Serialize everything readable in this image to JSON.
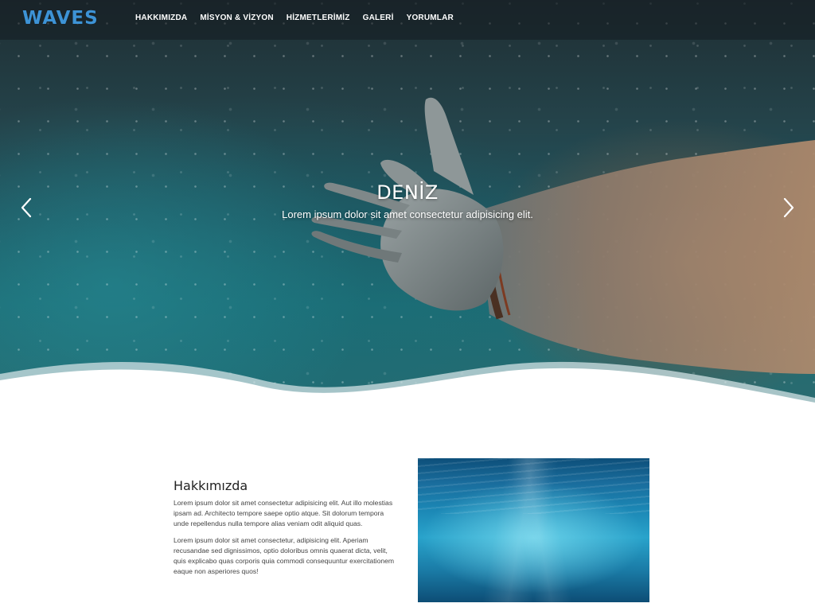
{
  "brand": {
    "logo_text": "WAVES",
    "logo_color": "#3d93d6"
  },
  "nav": {
    "items": [
      {
        "label": "HAKKIMIZDA"
      },
      {
        "label": "MİSYON & VİZYON"
      },
      {
        "label": "HİZMETLERİMİZ"
      },
      {
        "label": "GALERİ"
      },
      {
        "label": "YORUMLAR"
      }
    ]
  },
  "hero": {
    "title": "DENİZ",
    "subtitle": "Lorem ipsum dolor sit amet consectetur adipisicing elit.",
    "prev_icon": "chevron-left-icon",
    "next_icon": "chevron-right-icon"
  },
  "about": {
    "title": "Hakkımızda",
    "paragraphs": [
      "Lorem ipsum dolor sit amet consectetur adipisicing elit. Aut illo molestias ipsam ad. Architecto tempore saepe optio atque. Sit dolorum tempora unde repellendus nulla tempore alias veniam odit aliquid quas.",
      "Lorem ipsum dolor sit amet consectetur, adipisicing elit. Aperiam recusandae sed dignissimos, optio doloribus omnis quaerat dicta, velit, quis explicabo quas corporis quia commodi consequuntur exercitationem eaque non asperiores quos!"
    ]
  }
}
